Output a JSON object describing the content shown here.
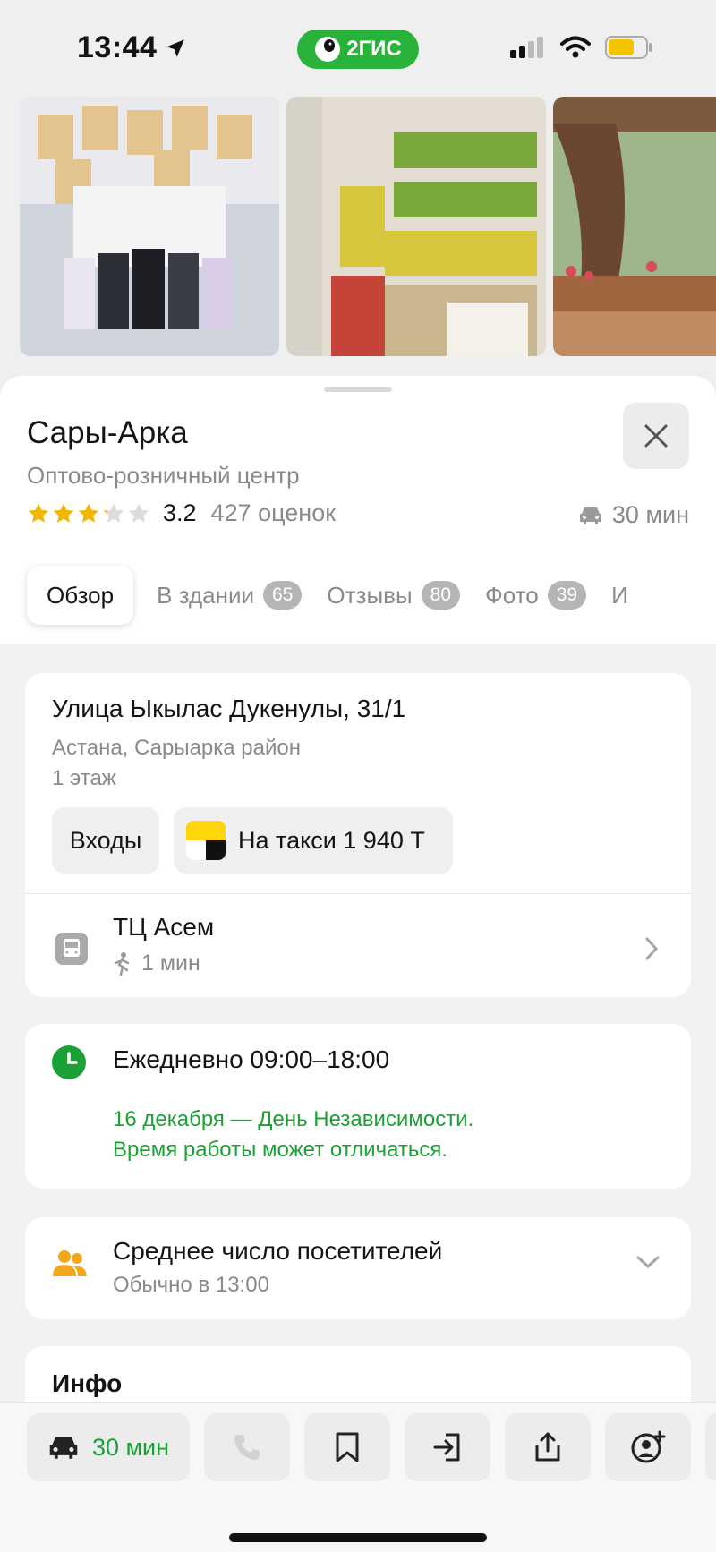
{
  "status_bar": {
    "time": "13:44",
    "brand": "2ГИС"
  },
  "place": {
    "name": "Сары-Арка",
    "category": "Оптово-розничный центр",
    "rating": "3.2",
    "rating_fraction": 0.64,
    "reviews_count": "427 оценок",
    "drive_time": "30 мин"
  },
  "tabs": [
    {
      "label": "Обзор",
      "badge": ""
    },
    {
      "label": "В здании",
      "badge": "65"
    },
    {
      "label": "Отзывы",
      "badge": "80"
    },
    {
      "label": "Фото",
      "badge": "39"
    },
    {
      "label": "И",
      "badge": ""
    }
  ],
  "address": {
    "street": "Улица Ыкылас Дукенулы, 31/1",
    "area": "Астана, Сарыарка район",
    "floor": "1 этаж",
    "entrances_label": "Входы",
    "taxi_label": "На такси 1 940 Т"
  },
  "transit": {
    "stop_name": "ТЦ Асем",
    "walk_time": "1 мин"
  },
  "hours": {
    "schedule": "Ежедневно 09:00–18:00",
    "holiday_line1": "16 декабря — День Независимости.",
    "holiday_line2": "Время работы может отличаться."
  },
  "visitors": {
    "title": "Среднее число посетителей",
    "subtitle": "Обычно в 13:00"
  },
  "info": {
    "title": "Инфо"
  },
  "bottom_bar": {
    "route_label": "30 мин"
  },
  "colors": {
    "brand_green": "#29b33b",
    "status_green": "#1ba136",
    "star": "#f2b600",
    "people_icon": "#f2a81d"
  }
}
